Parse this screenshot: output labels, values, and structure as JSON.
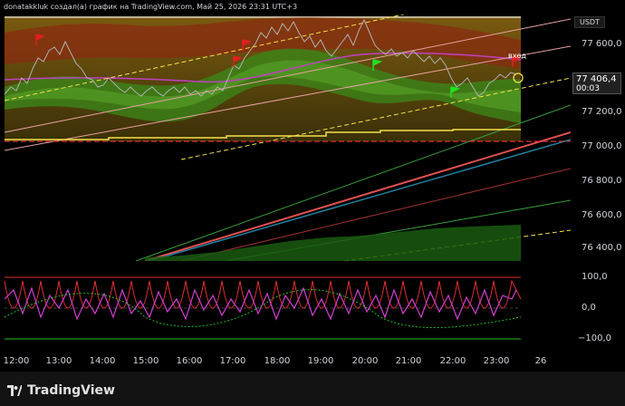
{
  "header": {
    "title": "donatakkluk создал(а) график на TradingView.com, Май 25, 2026 23:31 UTC+3"
  },
  "axis": {
    "currency": "USDT",
    "price_ticks": [
      "77 600,0",
      "77 400,0",
      "77 200,0",
      "77 000,0",
      "76 800,0",
      "76 600,0",
      "76 400,0"
    ],
    "current_price": "77 406,4",
    "countdown": "00:03",
    "osc_ticks": [
      "100,0",
      "0,0",
      "−100,0"
    ]
  },
  "time_axis": [
    "12:00",
    "13:00",
    "14:00",
    "15:00",
    "16:00",
    "17:00",
    "18:00",
    "19:00",
    "20:00",
    "21:00",
    "22:00",
    "23:00",
    "26"
  ],
  "annotation": {
    "entry_label": "вход"
  },
  "footer": {
    "brand": "TradingView"
  },
  "colors": {
    "bg": "#000000",
    "up_band": "#8b3a1a",
    "green_band": "#3a8a1a",
    "price_line": "#b0b0b0",
    "yellow": "#f5e04a",
    "magenta": "#d040d0",
    "red_osc": "#e03030"
  }
}
